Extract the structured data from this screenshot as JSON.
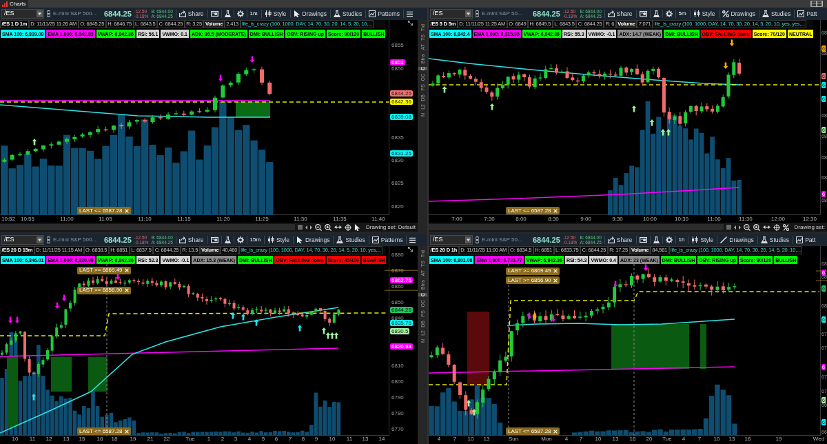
{
  "top_bar": {
    "tab": "Charts"
  },
  "panels": [
    {
      "toolbar": {
        "symbol": "/ES",
        "description": "E-mini S&P 500...",
        "last": "6844.25",
        "change": "-12.50",
        "change_percent": "-0.18%",
        "bid": "B: 6844.00",
        "ask": "A: 6844.25",
        "timeframe": "1m",
        "buttons": [
          {
            "kind": "share",
            "label": "Share"
          },
          {
            "kind": "style",
            "label": "Style"
          },
          {
            "kind": "drawings",
            "label": "Drawings"
          },
          {
            "kind": "studies",
            "label": "Studies"
          },
          {
            "kind": "patterns",
            "label": "Patterns"
          }
        ]
      },
      "info": {
        "title": "/ES 1 D 1m",
        "fields": [
          "D: 11/11/25 11:26 AM",
          "O: 6845.25",
          "H: 6846.75",
          "L: 6843.5",
          "C: 6844.25",
          "R: 3.25"
        ],
        "volume_label": "Volume",
        "volume": "2,413",
        "study": "life_is_crazy (100, 1000, DAY, 14, 70, 30, 20, 14, 5, 20, 10,..."
      },
      "badges": [
        {
          "text": "SMA 100: 6,839.08",
          "color": "#00ffff"
        },
        {
          "text": "EMA 1,000: 6,842.83",
          "color": "#ff00ff"
        },
        {
          "text": "VWAP: 6,842.36",
          "color": "#00ff00"
        },
        {
          "text": "RSI: 56.1",
          "color": "#d4d4d4"
        },
        {
          "text": "VWMO: 0.1",
          "color": "#d4d4d4"
        },
        {
          "text": "ADX: 30.5 (MODERATE)",
          "color": "#00ff00"
        },
        {
          "text": "DMI: BULLISH",
          "color": "#00ff00"
        },
        {
          "text": "OBV: RISING up",
          "color": "#00ff00"
        },
        {
          "text": "Score: 90/120",
          "color": "#00ff00"
        },
        {
          "text": "BULLISH",
          "color": "#00ff00"
        }
      ],
      "chart": {
        "price_ticks": [
          "6855",
          "6850",
          "6835",
          "6830",
          "6825",
          "6820"
        ],
        "price_labels": [
          {
            "text": "6851",
            "color": "#ff00ff"
          },
          {
            "text": "6844.25",
            "color": "#f87171"
          },
          {
            "text": "6842.36",
            "color": "#ffff00"
          },
          {
            "text": "6839.08",
            "color": "#00ffff"
          },
          {
            "text": "6831.25",
            "color": "#00ffff"
          }
        ],
        "alerts": [
          "LAST <= 6587.28"
        ],
        "time_ticks": [
          "10:52",
          "10:55",
          "11:00",
          "11:05",
          "11:10",
          "11:15",
          "11:20",
          "11:25",
          "11:30",
          "11:35",
          "11:40"
        ]
      },
      "side_tabs": [
        {
          "label": "Trd",
          "selected": false
        },
        {
          "label": "TS",
          "selected": false
        },
        {
          "label": "AT",
          "selected": false
        },
        {
          "label": "Btns",
          "selected": false
        },
        {
          "label": "C",
          "selected": true
        },
        {
          "label": "OC",
          "selected": false
        },
        {
          "label": "PS",
          "selected": false
        },
        {
          "label": "DB",
          "selected": false
        },
        {
          "label": "L2",
          "selected": false
        },
        {
          "label": "N",
          "selected": false
        }
      ],
      "footer": {
        "drawing_set": "Drawing set: Default"
      }
    },
    {
      "toolbar": {
        "symbol": "/ES",
        "description": "E-mini S&P 50...",
        "last": "6844.25",
        "change": "-12.50",
        "change_percent": "-0.18%",
        "bid": "B: 6844.00",
        "ask": "A: 6844.25",
        "timeframe": "5m",
        "buttons": [
          {
            "kind": "share",
            "label": "Share"
          },
          {
            "kind": "style",
            "label": "Style"
          },
          {
            "kind": "drawings",
            "label": "Drawings"
          },
          {
            "kind": "studies",
            "label": "Studies"
          },
          {
            "kind": "patterns",
            "label": "Patt"
          }
        ]
      },
      "info": {
        "title": "/ES 5 D 5m",
        "fields": [
          "D: 11/11/25 11:25 AM",
          "O: 6849",
          "H: 6849.5",
          "L: 6843.5",
          "C: 6844.25",
          "R: 6"
        ],
        "volume_label": "Volume",
        "volume": "7,071",
        "study": "life_is_crazy (100, 1000, DAY, 14, 70, 30, 20, 14, 5, 20, 10, yes, yes,..."
      },
      "badges": [
        {
          "text": "SMA 100: 6,842.4",
          "color": "#00ffff"
        },
        {
          "text": "EMA 1,000: 6,815.96",
          "color": "#ff00ff"
        },
        {
          "text": "VWAP: 6,842.36",
          "color": "#00ff00"
        },
        {
          "text": "RSI: 55.3",
          "color": "#d4d4d4"
        },
        {
          "text": "VWMO: -0.1",
          "color": "#d4d4d4"
        },
        {
          "text": "ADX: 14.7 (WEAK)",
          "color": "#8c8c8c"
        },
        {
          "text": "DMI: BULLISH",
          "color": "#00ff00"
        },
        {
          "text": "OBV: FALLING down",
          "color": "#ff0000"
        },
        {
          "text": "Score: 70/120",
          "color": "#ffff00"
        },
        {
          "text": "NEUTRAL",
          "color": "#ffff00"
        }
      ],
      "chart": {
        "price_ticks": [
          "68",
          "68",
          "68",
          "68",
          "68",
          "68",
          "68"
        ],
        "price_labels": [
          {
            "text": "6",
            "color": "#ffa500"
          },
          {
            "text": "6",
            "color": "#f26b6b"
          },
          {
            "text": "6",
            "color": "#00ffff"
          },
          {
            "text": "6",
            "color": "#00ffff"
          },
          {
            "text": "6",
            "color": "#90ee90"
          },
          {
            "text": "6",
            "color": "#ff00ff"
          }
        ],
        "alerts": [
          "LAST <= 6587.28"
        ],
        "time_ticks": [
          "7:00",
          "7:30",
          "8:00",
          "8:30",
          "9:00",
          "9:30",
          "10:00",
          "10:30",
          "11:00",
          "11:30",
          "12:00",
          "12:30"
        ]
      },
      "footer": {
        "drawing_set": "Drawing set:"
      }
    },
    {
      "toolbar": {
        "symbol": "/ES",
        "description": "E-mini S&P 500...",
        "last": "6844.25",
        "change": "-12.50",
        "change_percent": "-0.18%",
        "bid": "B: 6844.00",
        "ask": "A: 6844.25",
        "timeframe": "15m",
        "buttons": [
          {
            "kind": "share",
            "label": "Share"
          },
          {
            "kind": "style",
            "label": "Style"
          },
          {
            "kind": "drawings",
            "label": "Drawings"
          },
          {
            "kind": "studies",
            "label": "Studies"
          },
          {
            "kind": "patterns",
            "label": "Patterns"
          }
        ]
      },
      "info": {
        "title": "/ES 20 D 15m",
        "fields": [
          "D: 11/11/25 11:15 AM",
          "O: 6838.5",
          "H: 6851",
          "L: 6837.5",
          "C: 6844.25",
          "R: 13.5"
        ],
        "volume_label": "Volume",
        "volume": "40,460",
        "study": "life_is_crazy (100, 1000, DAY, 14, 70, 30, 20, 14, 5, 20, 10, yes,..."
      },
      "badges": [
        {
          "text": "SMA 100: 6,846.01",
          "color": "#00ffff"
        },
        {
          "text": "EMA 1,000: 6,820.98",
          "color": "#ff00ff"
        },
        {
          "text": "VWAP: 6,842.36",
          "color": "#00ff00"
        },
        {
          "text": "RSI: 52.3",
          "color": "#d4d4d4"
        },
        {
          "text": "VWMO: -0.1",
          "color": "#d4d4d4"
        },
        {
          "text": "ADX: 15.3 (WEAK)",
          "color": "#8c8c8c"
        },
        {
          "text": "DMI: BULLISH",
          "color": "#00ff00"
        },
        {
          "text": "OBV: FALLING down",
          "color": "#ff0000"
        },
        {
          "text": "Score: 45/120",
          "color": "#ff0000"
        },
        {
          "text": "BEARISH",
          "color": "#ff0000"
        }
      ],
      "chart": {
        "price_ticks": [
          "6880",
          "6870",
          "6860",
          "6850",
          "6840",
          "6810",
          "6800",
          "6790",
          "6780",
          "6770"
        ],
        "price_labels": [
          {
            "text": "6862.75",
            "color": "#ff00ff"
          },
          {
            "text": "6844.25",
            "color": "#22c55e"
          },
          {
            "text": "6835.75",
            "color": "#00ffff"
          },
          {
            "text": "6830.5",
            "color": "#a7f3a0"
          },
          {
            "text": "6820.98",
            "color": "#ff00ff"
          }
        ],
        "alerts": [
          "LAST >= 6869.49",
          "LAST >= 6856.90",
          "LAST <= 6587.28"
        ],
        "time_ticks": [
          "10",
          "11",
          "12",
          "13",
          "15",
          "16",
          "18",
          "19",
          "21",
          "22",
          "Tue",
          "1",
          "2",
          "3",
          "4",
          "5",
          "6",
          "7",
          "8",
          "9",
          "10",
          "11",
          "13",
          "14"
        ]
      },
      "side_tabs": [
        {
          "label": "Trd",
          "selected": false
        },
        {
          "label": "TS",
          "selected": false
        },
        {
          "label": "AT",
          "selected": false
        },
        {
          "label": "Btns",
          "selected": false
        },
        {
          "label": "C",
          "selected": true
        },
        {
          "label": "OC",
          "selected": false
        },
        {
          "label": "PS",
          "selected": false
        },
        {
          "label": "DB",
          "selected": false
        },
        {
          "label": "L2",
          "selected": false
        },
        {
          "label": "N",
          "selected": false
        }
      ]
    },
    {
      "toolbar": {
        "symbol": "/ES",
        "description": "E-mini S&P 50...",
        "last": "6844.25",
        "change": "-12.50",
        "change_percent": "-0.18%",
        "bid": "B: 6844.00",
        "ask": "A: 6844.25",
        "timeframe": "1h",
        "buttons": [
          {
            "kind": "share",
            "label": "Share"
          },
          {
            "kind": "style",
            "label": "Style"
          },
          {
            "kind": "drawings",
            "label": "Drawings"
          },
          {
            "kind": "studies",
            "label": "Studies"
          },
          {
            "kind": "patterns",
            "label": "Patt"
          }
        ]
      },
      "info": {
        "title": "/ES 20 D 1h",
        "fields": [
          "D: 11/11/25 11:00 AM",
          "O: 6834.5",
          "H: 6851",
          "L: 6833.75",
          "C: 6844.25",
          "R: 17.25"
        ],
        "volume_label": "Volume",
        "volume": "84,561",
        "study": "life_is_crazy (100, 1000, DAY, 14, 70, 30, 20, 14, 5, 20, 10,..."
      },
      "badges": [
        {
          "text": "SMA 100: 6,801.08",
          "color": "#00ffff"
        },
        {
          "text": "EMA 1,000: 6,733.77",
          "color": "#ff00ff"
        },
        {
          "text": "VWAP: 6,842.36",
          "color": "#00ff00"
        },
        {
          "text": "RSI: 54.3",
          "color": "#d4d4d4"
        },
        {
          "text": "VWMO: 0.4",
          "color": "#d4d4d4"
        },
        {
          "text": "ADX: 23 (WEAK)",
          "color": "#8c8c8c"
        },
        {
          "text": "DMI: BULLISH",
          "color": "#00ff00"
        },
        {
          "text": "OBV: RISING up",
          "color": "#00ff00"
        },
        {
          "text": "Score: 80/120",
          "color": "#00ff00"
        },
        {
          "text": "BULLISH",
          "color": "#00ff00"
        }
      ],
      "chart": {
        "price_ticks": [
          "68",
          "68",
          "68",
          "67",
          "67",
          "67",
          "67",
          "66",
          "66"
        ],
        "price_labels": [
          {
            "text": "6",
            "color": "#ff00ff"
          },
          {
            "text": "6",
            "color": "#22c55e"
          },
          {
            "text": "6",
            "color": "#00ffff"
          },
          {
            "text": "6",
            "color": "#ff00ff"
          },
          {
            "text": "6",
            "color": "#a7f3a0"
          },
          {
            "text": "6",
            "color": "#00ffff"
          }
        ],
        "alerts": [
          "LAST >= 6869.49",
          "LAST >= 6856.90",
          "LAST <= 6587.28"
        ],
        "time_ticks": [
          "4",
          "7",
          "10",
          "13",
          "Sun",
          "Mon",
          "4",
          "7",
          "10",
          "13",
          "16",
          "20",
          "Tue",
          "4",
          "7",
          "10",
          "13",
          "16",
          "19",
          "Wed"
        ]
      }
    }
  ]
}
